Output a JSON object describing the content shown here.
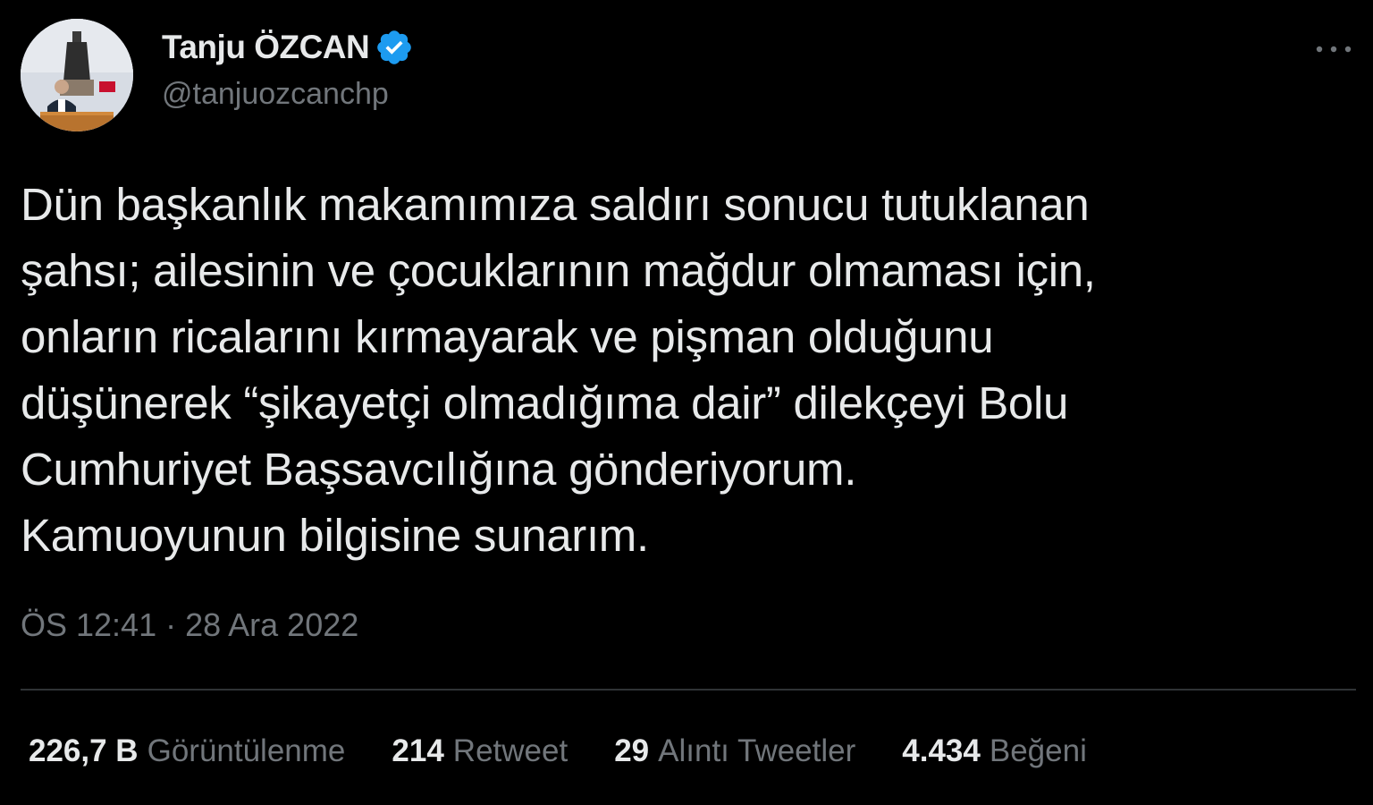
{
  "author": {
    "display_name": "Tanju ÖZCAN",
    "handle": "@tanjuozcanchp",
    "verified": true,
    "verified_color": "#1d9bf0",
    "avatar_alt": "Profile photo"
  },
  "more_icon": "ellipsis-horizontal-icon",
  "tweet": {
    "lines": [
      "Dün başkanlık makamımıza saldırı sonucu tutuklanan",
      "şahsı; ailesinin ve çocuklarının mağdur olmaması için,",
      "onların ricalarını kırmayarak ve pişman olduğunu",
      "düşünerek “şikayetçi olmadığıma dair” dilekçeyi Bolu",
      "Cumhuriyet Başsavcılığına gönderiyorum.",
      "Kamuoyunun bilgisine sunarım."
    ],
    "timestamp": "ÖS 12:41 · 28 Ara 2022"
  },
  "stats": [
    {
      "value": "226,7 B",
      "label": "Görüntülenme"
    },
    {
      "value": "214",
      "label": "Retweet"
    },
    {
      "value": "29",
      "label": "Alıntı Tweetler"
    },
    {
      "value": "4.434",
      "label": "Beğeni"
    }
  ],
  "colors": {
    "background": "#000000",
    "text_primary": "#e7e9ea",
    "text_secondary": "#71767b",
    "divider": "#2f3336",
    "accent": "#1d9bf0"
  }
}
